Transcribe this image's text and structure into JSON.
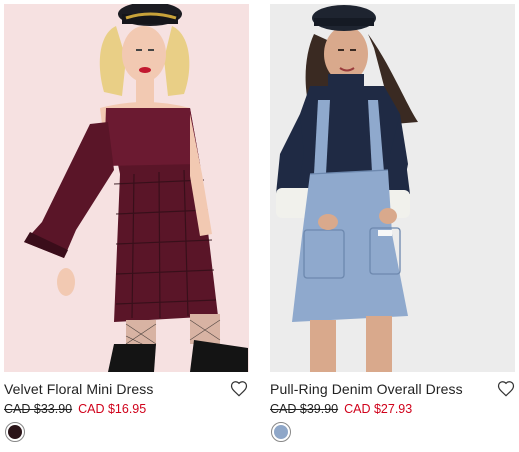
{
  "products": [
    {
      "name": "Velvet Floral Mini Dress",
      "original_price": "CAD $33.90",
      "sale_price": "CAD $16.95",
      "swatch_color": "#2a1418",
      "photo_background": "#f6e1e1"
    },
    {
      "name": "Pull-Ring Denim Overall Dress",
      "original_price": "CAD $39.90",
      "sale_price": "CAD $27.93",
      "swatch_color": "#8fa7c8",
      "photo_background": "#ececec"
    }
  ],
  "icons": {
    "wishlist": "heart-outline-icon"
  },
  "colors": {
    "sale_price": "#d0021b",
    "text": "#222222"
  }
}
